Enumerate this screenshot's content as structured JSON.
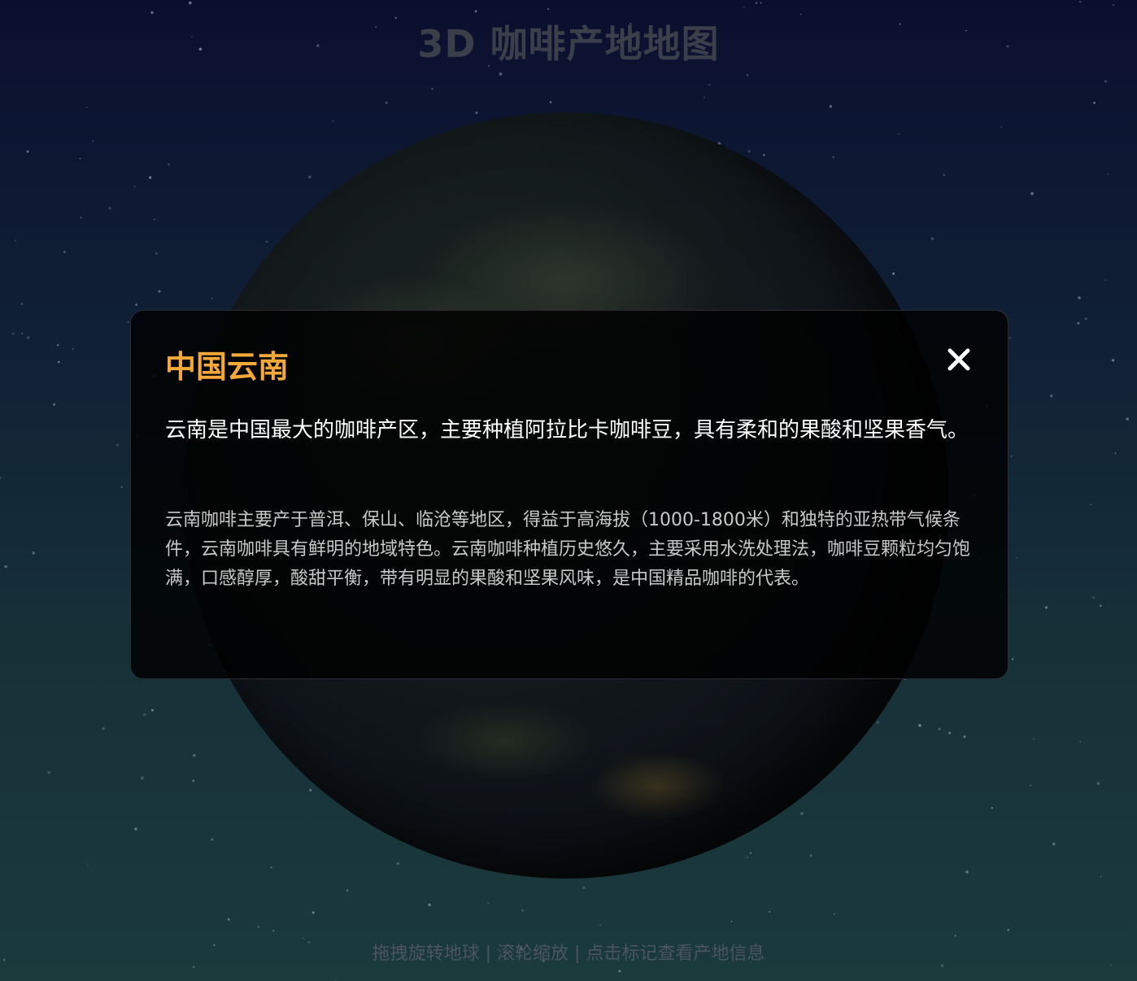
{
  "page": {
    "title": "3D 咖啡产地地图",
    "hint": "拖拽旋转地球 | 滚轮缩放 | 点击标记查看产地信息"
  },
  "modal": {
    "title": "中国云南",
    "summary": "云南是中国最大的咖啡产区，主要种植阿拉比卡咖啡豆，具有柔和的果酸和坚果香气。",
    "detail": "云南咖啡主要产于普洱、保山、临沧等地区，得益于高海拔（1000-1800米）和独特的亚热带气候条件，云南咖啡具有鲜明的地域特色。云南咖啡种植历史悠久，主要采用水洗处理法，咖啡豆颗粒均匀饱满，口感醇厚，酸甜平衡，带有明显的果酸和坚果风味，是中国精品咖啡的代表。",
    "close_icon": "close-icon"
  },
  "colors": {
    "accent": "#f5a83a",
    "title_muted": "#3a3f4a",
    "hint": "#4a5560"
  }
}
